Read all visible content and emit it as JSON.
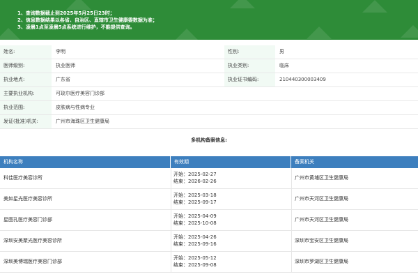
{
  "notice": {
    "lines": [
      "1、查询数据截止到2025年5月25日23时；",
      "2、信息数据结果以各省、自治区、直辖市卫生健康委数据为准；",
      "3、凌晨1点至凌晨5点系统进行维护，不能提供查询。"
    ],
    "background_color": "#2e8c38"
  },
  "doctor_info": {
    "rows": [
      {
        "label1": "姓名:",
        "value1": "李明",
        "label2": "性别:",
        "value2": "男"
      },
      {
        "label1": "医师级别:",
        "value1": "执业医师",
        "label2": "执业类别:",
        "value2": "临床"
      },
      {
        "label1": "执业地点:",
        "value1": "广东省",
        "label2": "执业证书编码:",
        "value2": "210440300003409"
      },
      {
        "label1": "主要执业机构:",
        "value1": "可玫尔医疗美容门诊部"
      },
      {
        "label1": "执业范围:",
        "value1": "皮肤病与性病专业"
      },
      {
        "label1": "发证(批准)机关:",
        "value1": "广州市海珠区卫生健康局"
      }
    ]
  },
  "multi_institution": {
    "title": "多机构备案信息:",
    "header_color": "#3d7fbe",
    "columns": [
      "机构名称",
      "有效期",
      "备案机关"
    ],
    "rows": [
      {
        "name": "科佳医疗美容诊所",
        "start": "开始：2025-02-27",
        "end": "结束：2026-02-26",
        "authority": "广州市黄埔区卫生健康局"
      },
      {
        "name": "美如星光医疗美容诊所",
        "start": "开始：2025-03-18",
        "end": "结束：2025-09-17",
        "authority": "广州市天河区卫生健康局"
      },
      {
        "name": "星图孔医疗美容门诊部",
        "start": "开始：2025-04-09",
        "end": "结束：2025-10-08",
        "authority": "广州市天河区卫生健康局"
      },
      {
        "name": "深圳安美聚光医疗美容诊所",
        "start": "开始：2025-04-26",
        "end": "结束：2025-09-16",
        "authority": "深圳市宝安区卫生健康局"
      },
      {
        "name": "深圳美博瑞医疗美容门诊部",
        "start": "开始：2025-05-12",
        "end": "结束：2025-09-08",
        "authority": "深圳市罗湖区卫生健康局"
      }
    ]
  }
}
